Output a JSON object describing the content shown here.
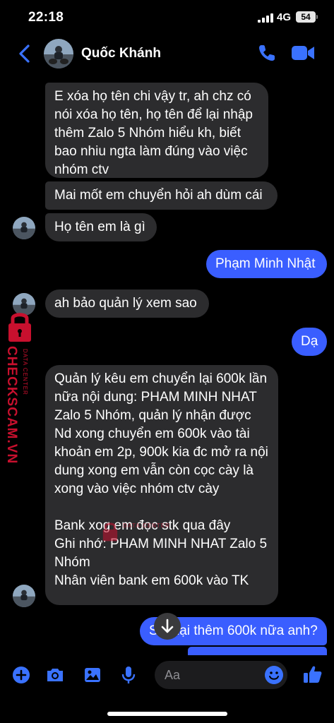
{
  "status_bar": {
    "time": "22:18",
    "network": "4G",
    "battery": "54"
  },
  "header": {
    "contact_name": "Quốc Khánh"
  },
  "messages": [
    {
      "side": "in",
      "text": "E xóa họ tên chi vậy tr, ah chz có nói xóa họ tên, họ tên để lại nhập thêm Zalo 5 Nhóm hiểu kh, biết bao nhiu ngta làm đúng vào việc nhóm ctv"
    },
    {
      "side": "in",
      "text": "Mai mốt em chuyển hỏi ah dùm cái"
    },
    {
      "side": "in",
      "text": "Họ tên em là gì"
    },
    {
      "side": "out",
      "text": "Phạm Minh Nhật"
    },
    {
      "side": "in",
      "text": "ah bảo quản lý xem sao"
    },
    {
      "side": "out",
      "text": "Dạ"
    },
    {
      "side": "in",
      "text": "Quản lý kêu em chuyển lại 600k lần nữa nội dung: PHAM MINH NHAT Zalo 5 Nhóm, quản lý nhận được Nd xong chuyển em 600k vào tài khoản em 2p, 900k kia đc mở ra nội dung xong em vẫn còn cọc cày là xong vào việc nhóm ctv cày\n\nBank xog em đọc stk qua đây\nGhi nhớ: PHAM MINH NHAT Zalo 5 Nhóm\nNhân viên bank em 600k vào TK"
    },
    {
      "side": "out",
      "text": "Sao lại thêm 600k nữa anh?"
    }
  ],
  "composer": {
    "placeholder": "Aa"
  },
  "watermark": {
    "side_text": "CHECKSCAM.VN",
    "side_sub": "DATA CENTER",
    "center_text": "DATA CENTER"
  },
  "colors": {
    "outgoing": "#3a5eff",
    "incoming": "#2c2c2e",
    "accent": "#3a72ff",
    "watermark": "#c8102e"
  }
}
